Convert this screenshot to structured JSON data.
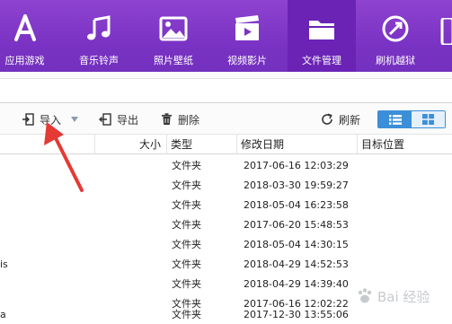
{
  "nav": {
    "items": [
      {
        "label": "应用游戏",
        "icon": "app-store-icon"
      },
      {
        "label": "音乐铃声",
        "icon": "music-note-icon"
      },
      {
        "label": "照片壁纸",
        "icon": "photo-icon"
      },
      {
        "label": "视频影片",
        "icon": "video-clapper-icon"
      },
      {
        "label": "文件管理",
        "icon": "folder-icon"
      },
      {
        "label": "刷机越狱",
        "icon": "flash-jailbreak-icon"
      }
    ],
    "active_index": 4
  },
  "toolbar": {
    "import_label": "导入",
    "export_label": "导出",
    "delete_label": "删除",
    "refresh_label": "刷新"
  },
  "table": {
    "headers": {
      "size": "大小",
      "type": "类型",
      "modified": "修改日期",
      "target": "目标位置"
    },
    "rows": [
      {
        "name": "",
        "type": "文件夹",
        "modified": "2017-06-16 12:03:29"
      },
      {
        "name": "",
        "type": "文件夹",
        "modified": "2018-03-30 19:59:27"
      },
      {
        "name": "",
        "type": "文件夹",
        "modified": "2018-05-04 16:23:58"
      },
      {
        "name": "",
        "type": "文件夹",
        "modified": "2017-06-20 15:48:53"
      },
      {
        "name": "",
        "type": "文件夹",
        "modified": "2018-05-04 14:30:15"
      },
      {
        "name": "is",
        "type": "文件夹",
        "modified": "2018-04-29 14:52:53"
      },
      {
        "name": "",
        "type": "文件夹",
        "modified": "2018-04-29 14:39:40"
      },
      {
        "name": "",
        "type": "文件夹",
        "modified": "2017-06-16 12:02:22"
      },
      {
        "name": "a",
        "type": "文件夹",
        "modified": "2017-12-30 13:55:06"
      }
    ]
  },
  "watermark": {
    "text": "Bai 经验"
  },
  "colors": {
    "nav_bg": "#7a33c4",
    "nav_active": "#6a23b5",
    "accent_blue": "#3b8fd8",
    "annotation_red": "#e53935"
  }
}
